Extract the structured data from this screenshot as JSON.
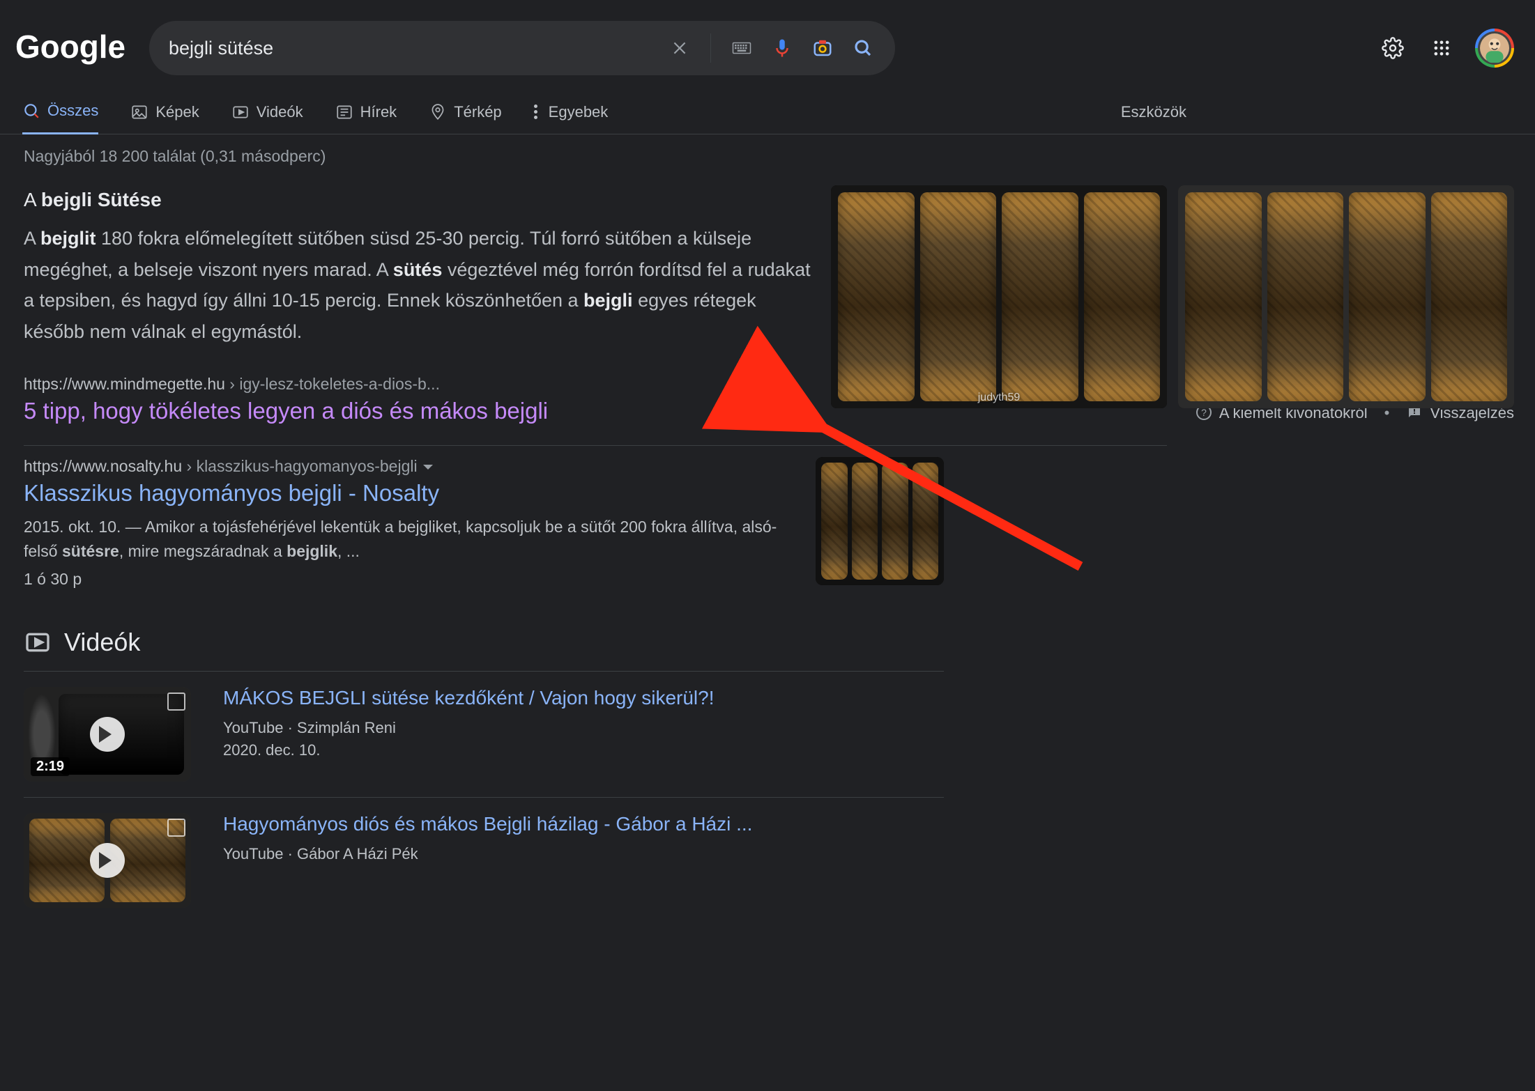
{
  "search": {
    "query": "bejgli sütése",
    "placeholder": ""
  },
  "nav": {
    "all": "Összes",
    "images": "Képek",
    "videos": "Videók",
    "news": "Hírek",
    "maps": "Térkép",
    "more": "Egyebek",
    "tools": "Eszközök"
  },
  "stats": "Nagyjából 18 200 találat (0,31 másodperc)",
  "featured": {
    "heading_pre": "A ",
    "heading_bold": "bejgli Sütése",
    "body_html": "A <b>bejglit</b> 180 fokra előmelegített sütőben süsd 25-30 percig. Túl forró sütőben a külseje megéghet, a belseje viszont nyers marad. A <b>sütés</b> végeztével még forrón fordítsd fel a rudakat a tepsiben, és hagyd így állni 10-15 percig. Ennek köszönhetően a <b>bejgli</b> egyes rétegek később nem válnak el egymástól.",
    "source_domain": "https://www.mindmegette.hu",
    "source_path": " › igy-lesz-tokeletes-a-dios-b...",
    "source_title": "5 tipp, hogy tökéletes legyen a diós és mákos bejgli",
    "img1_label": "judyth59",
    "about_label": "A kiemelt kivonatokról",
    "feedback_label": "Visszajelzés"
  },
  "result1": {
    "domain": "https://www.nosalty.hu",
    "path": " › klasszikus-hagyomanyos-bejgli",
    "title": "Klasszikus hagyományos bejgli - Nosalty",
    "date": "2015. okt. 10.",
    "snippet_sep": " — ",
    "snippet_html": "Amikor a tojásfehérjével lekentük a bejgliket, kapcsoljuk be a sütőt 200 fokra állítva, alsó-felső <b>sütésre</b>, mire megszáradnak a <b>bejglik</b>, ...",
    "meta": "1 ó 30 p"
  },
  "videos_heading": "Videók",
  "video1": {
    "title": "MÁKOS BEJGLI sütése kezdőként / Vajon hogy sikerül?!",
    "site": "YouTube",
    "author": "Szimplán Reni",
    "date": "2020. dec. 10.",
    "duration": "2:19"
  },
  "video2": {
    "title": "Hagyományos diós és mákos Bejgli házilag - Gábor a Házi ...",
    "site": "YouTube",
    "author": "Gábor A Házi Pék"
  }
}
